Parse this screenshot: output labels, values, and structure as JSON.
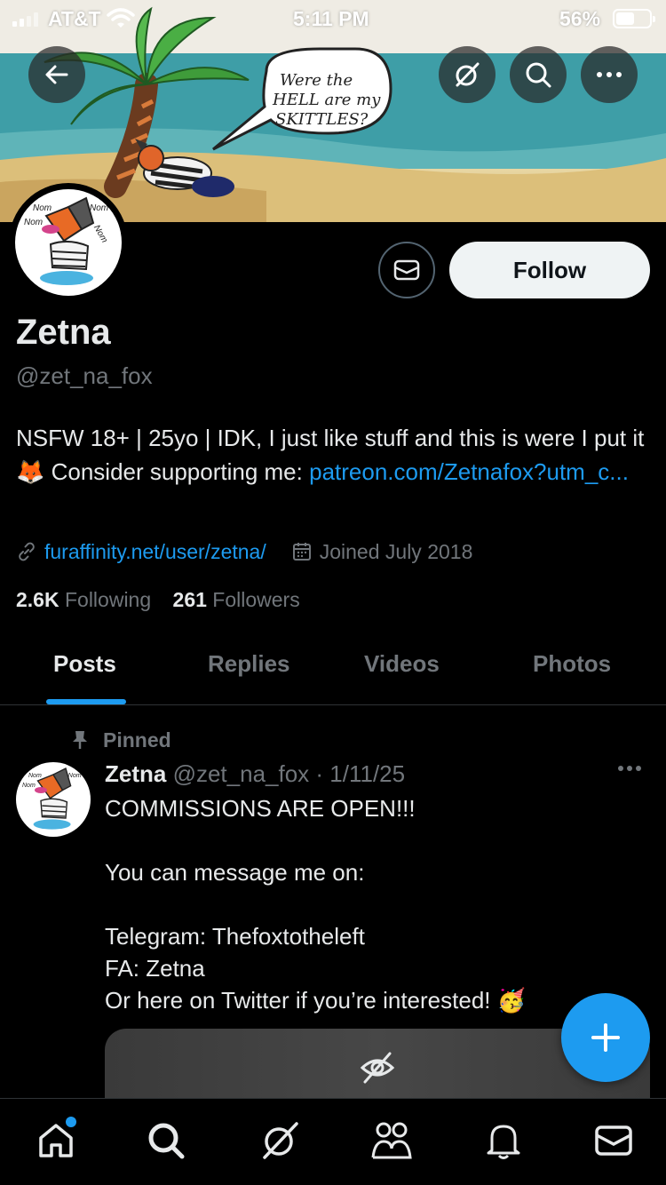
{
  "status_bar": {
    "carrier": "AT&T",
    "time": "5:11 PM",
    "battery_percent": "56%",
    "battery_level": 0.56
  },
  "banner": {
    "speech_line1": "Were  the",
    "speech_line2": "HELL are my",
    "speech_line3": "SKITTLES?"
  },
  "avatar_doodle": {
    "nom": "Nom"
  },
  "icons": {
    "back": "back-arrow-icon",
    "grok": "grok-icon",
    "search": "search-icon",
    "more": "more-icon",
    "message": "envelope-icon"
  },
  "profile": {
    "follow_label": "Follow",
    "display_name": "Zetna",
    "handle": "@zet_na_fox",
    "bio_text": "NSFW 18+ | 25yo | IDK, I just like stuff and this is were I put it",
    "bio_emoji": "🦊",
    "bio_support": "Consider supporting me:",
    "bio_link": "patreon.com/Zetnafox?utm_c...",
    "website": "furaffinity.net/user/zetna/",
    "joined": "Joined July 2018",
    "following_count": "2.6K",
    "following_label": "Following",
    "followers_count": "261",
    "followers_label": "Followers"
  },
  "tabs": [
    {
      "label": "Posts",
      "active": true
    },
    {
      "label": "Replies",
      "active": false
    },
    {
      "label": "Videos",
      "active": false
    },
    {
      "label": "Photos",
      "active": false
    }
  ],
  "post": {
    "pinned_label": "Pinned",
    "author": "Zetna",
    "handle_date": "@zet_na_fox · 1/11/25",
    "text": "COMMISSIONS ARE OPEN!!!\n\nYou can message me on:\n\nTelegram: Thefoxtotheleft\nFA: Zetna\nOr here on Twitter if you’re interested!",
    "emoji": "🥳"
  },
  "colors": {
    "accent": "#1d9bf0",
    "background": "#000000",
    "primary_text": "#e7e9ea",
    "secondary_text": "#71767b",
    "divider": "#2f3336"
  },
  "bottom_nav": [
    {
      "name": "home",
      "icon": "home-icon",
      "active": true
    },
    {
      "name": "search",
      "icon": "search-icon",
      "active": false
    },
    {
      "name": "grok",
      "icon": "grok-icon",
      "active": false
    },
    {
      "name": "communities",
      "icon": "people-icon",
      "active": false
    },
    {
      "name": "notifications",
      "icon": "bell-icon",
      "active": false
    },
    {
      "name": "messages",
      "icon": "envelope-icon",
      "active": false
    }
  ]
}
